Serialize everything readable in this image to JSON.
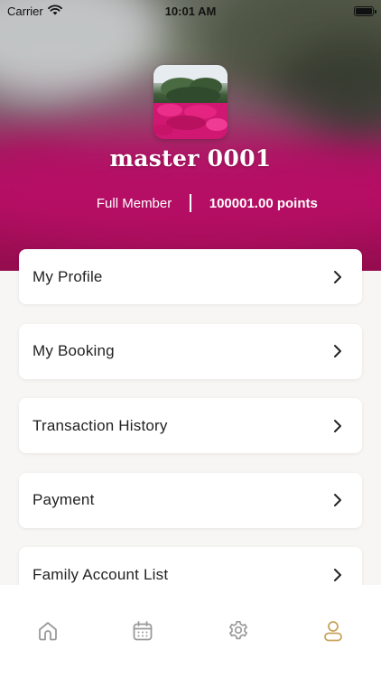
{
  "status_bar": {
    "carrier": "Carrier",
    "time": "10:01 AM"
  },
  "profile": {
    "name": "master 0001",
    "tier": "Full Member",
    "points": "100001.00 points"
  },
  "menu": [
    {
      "label": "My Profile",
      "icon": "chevron-right-icon"
    },
    {
      "label": "My Booking",
      "icon": "chevron-right-icon"
    },
    {
      "label": "Transaction History",
      "icon": "chevron-right-icon"
    },
    {
      "label": "Payment",
      "icon": "chevron-right-icon"
    },
    {
      "label": "Family Account List",
      "icon": "chevron-right-icon"
    }
  ],
  "tabs": [
    {
      "icon": "home-icon",
      "active": false
    },
    {
      "icon": "calendar-icon",
      "active": false
    },
    {
      "icon": "gear-icon",
      "active": false
    },
    {
      "icon": "user-icon",
      "active": true
    }
  ],
  "colors": {
    "accent": "#c9a45c",
    "tab_inactive": "#9a9a9a",
    "hero_magenta": "#c2106a",
    "background": "#f7f6f4"
  }
}
